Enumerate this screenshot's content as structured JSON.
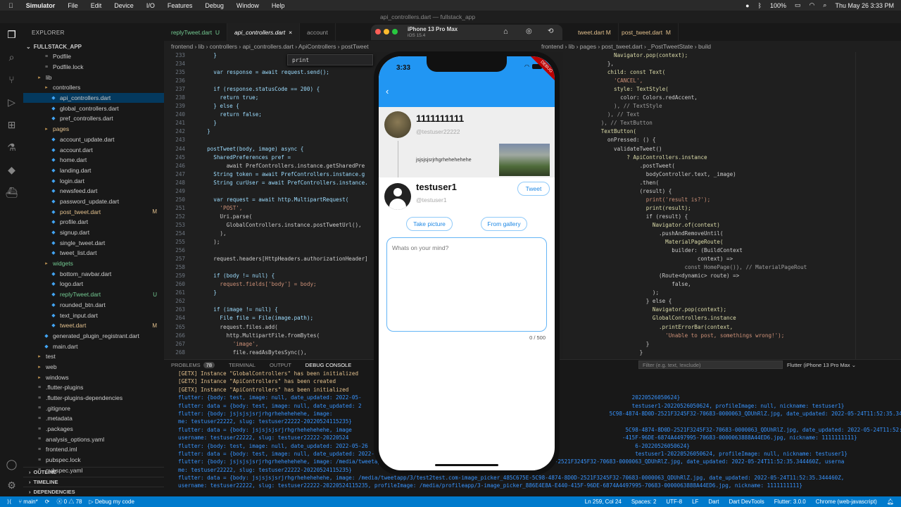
{
  "menubar": {
    "app": "Simulator",
    "items": [
      "File",
      "Edit",
      "Device",
      "I/O",
      "Features",
      "Debug",
      "Window",
      "Help"
    ],
    "battery": "100%",
    "datetime": "Thu May 26 3:33 PM"
  },
  "window_title": "api_controllers.dart — fullstack_app",
  "explorer": {
    "header": "EXPLORER",
    "project": "FULLSTACK_APP",
    "items": [
      {
        "label": "Podfile",
        "indent": 2,
        "kind": "file"
      },
      {
        "label": "Podfile.lock",
        "indent": 2,
        "kind": "file"
      },
      {
        "label": "lib",
        "indent": 1,
        "kind": "folder"
      },
      {
        "label": "controllers",
        "indent": 2,
        "kind": "folder"
      },
      {
        "label": "api_controllers.dart",
        "indent": 3,
        "kind": "dart",
        "selected": true
      },
      {
        "label": "global_controllers.dart",
        "indent": 3,
        "kind": "dart"
      },
      {
        "label": "pref_controllers.dart",
        "indent": 3,
        "kind": "dart"
      },
      {
        "label": "pages",
        "indent": 2,
        "kind": "folder",
        "color": "#e2c08d"
      },
      {
        "label": "account_update.dart",
        "indent": 3,
        "kind": "dart"
      },
      {
        "label": "account.dart",
        "indent": 3,
        "kind": "dart"
      },
      {
        "label": "home.dart",
        "indent": 3,
        "kind": "dart"
      },
      {
        "label": "landing.dart",
        "indent": 3,
        "kind": "dart"
      },
      {
        "label": "login.dart",
        "indent": 3,
        "kind": "dart"
      },
      {
        "label": "newsfeed.dart",
        "indent": 3,
        "kind": "dart"
      },
      {
        "label": "password_update.dart",
        "indent": 3,
        "kind": "dart"
      },
      {
        "label": "post_tweet.dart",
        "indent": 3,
        "kind": "dart",
        "color": "#e2c08d",
        "badge": "M"
      },
      {
        "label": "profile.dart",
        "indent": 3,
        "kind": "dart"
      },
      {
        "label": "signup.dart",
        "indent": 3,
        "kind": "dart"
      },
      {
        "label": "single_tweet.dart",
        "indent": 3,
        "kind": "dart"
      },
      {
        "label": "tweet_list.dart",
        "indent": 3,
        "kind": "dart"
      },
      {
        "label": "widgets",
        "indent": 2,
        "kind": "folder",
        "color": "#73c991"
      },
      {
        "label": "bottom_navbar.dart",
        "indent": 3,
        "kind": "dart"
      },
      {
        "label": "logo.dart",
        "indent": 3,
        "kind": "dart"
      },
      {
        "label": "replyTweet.dart",
        "indent": 3,
        "kind": "dart",
        "color": "#73c991",
        "badge": "U"
      },
      {
        "label": "rounded_btn.dart",
        "indent": 3,
        "kind": "dart"
      },
      {
        "label": "text_input.dart",
        "indent": 3,
        "kind": "dart"
      },
      {
        "label": "tweet.dart",
        "indent": 3,
        "kind": "dart",
        "color": "#e2c08d",
        "badge": "M"
      },
      {
        "label": "generated_plugin_registrant.dart",
        "indent": 2,
        "kind": "dart"
      },
      {
        "label": "main.dart",
        "indent": 2,
        "kind": "dart"
      },
      {
        "label": "test",
        "indent": 1,
        "kind": "folder"
      },
      {
        "label": "web",
        "indent": 1,
        "kind": "folder"
      },
      {
        "label": "windows",
        "indent": 1,
        "kind": "folder"
      },
      {
        "label": ".flutter-plugins",
        "indent": 1,
        "kind": "file"
      },
      {
        "label": ".flutter-plugins-dependencies",
        "indent": 1,
        "kind": "file"
      },
      {
        "label": ".gitignore",
        "indent": 1,
        "kind": "file"
      },
      {
        "label": ".metadata",
        "indent": 1,
        "kind": "file"
      },
      {
        "label": ".packages",
        "indent": 1,
        "kind": "file"
      },
      {
        "label": "analysis_options.yaml",
        "indent": 1,
        "kind": "file"
      },
      {
        "label": "frontend.iml",
        "indent": 1,
        "kind": "file"
      },
      {
        "label": "pubspec.lock",
        "indent": 1,
        "kind": "file"
      },
      {
        "label": "pubspec.yaml",
        "indent": 1,
        "kind": "file"
      }
    ],
    "outline": "OUTLINE",
    "timeline": "TIMELINE",
    "dependencies": "DEPENDENCIES"
  },
  "tabs": [
    {
      "label": "replyTweet.dart",
      "badge": "U"
    },
    {
      "label": "api_controllers.dart",
      "active": true
    },
    {
      "label": "account"
    },
    {
      "label": "tweet.dart",
      "badge": "M"
    },
    {
      "label": "post_tweet.dart",
      "badge": "M"
    }
  ],
  "breadcrumb_left": "frontend › lib › controllers › api_controllers.dart › ApiControllers › postTweet",
  "breadcrumb_right": "frontend › lib › pages › post_tweet.dart › _PostTweetState › build",
  "find_text": "print",
  "code_left": [
    {
      "n": "233",
      "t": "    }"
    },
    {
      "n": "234",
      "t": ""
    },
    {
      "n": "235",
      "t": "    var response = await request.send();"
    },
    {
      "n": "236",
      "t": ""
    },
    {
      "n": "237",
      "t": "    if (response.statusCode == 200) {"
    },
    {
      "n": "238",
      "t": "      return true;"
    },
    {
      "n": "239",
      "t": "    } else {"
    },
    {
      "n": "240",
      "t": "      return false;"
    },
    {
      "n": "241",
      "t": "    }"
    },
    {
      "n": "242",
      "t": "  }"
    },
    {
      "n": "243",
      "t": ""
    },
    {
      "n": "244",
      "t": "  postTweet(body, image) async {"
    },
    {
      "n": "245",
      "t": "    SharedPreferences pref ="
    },
    {
      "n": "246",
      "t": "        await PrefControllers.instance.getSharedPre"
    },
    {
      "n": "247",
      "t": "    String token = await PrefControllers.instance.g"
    },
    {
      "n": "248",
      "t": "    String curUser = await PrefControllers.instance."
    },
    {
      "n": "249",
      "t": ""
    },
    {
      "n": "250",
      "t": "    var request = await http.MultipartRequest("
    },
    {
      "n": "251",
      "t": "      'POST',"
    },
    {
      "n": "252",
      "t": "      Uri.parse("
    },
    {
      "n": "253",
      "t": "        GlobalControllers.instance.postTweetUrl(),"
    },
    {
      "n": "254",
      "t": "      ),"
    },
    {
      "n": "255",
      "t": "    );"
    },
    {
      "n": "256",
      "t": ""
    },
    {
      "n": "257",
      "t": "    request.headers[HttpHeaders.authorizationHeader]"
    },
    {
      "n": "258",
      "t": ""
    },
    {
      "n": "259",
      "t": "    if (body != null) {"
    },
    {
      "n": "260",
      "t": "      request.fields['body'] = body;"
    },
    {
      "n": "261",
      "t": "    }"
    },
    {
      "n": "262",
      "t": ""
    },
    {
      "n": "263",
      "t": "    if (image != null) {"
    },
    {
      "n": "264",
      "t": "      File file = File(image.path);"
    },
    {
      "n": "265",
      "t": "      request.files.add("
    },
    {
      "n": "266",
      "t": "        http.MultipartFile.fromBytes("
    },
    {
      "n": "267",
      "t": "          'image',"
    },
    {
      "n": "268",
      "t": "          file.readAsBytesSync(),"
    }
  ],
  "code_right": [
    "              Navigator.pop(context);",
    "            },",
    "            child: const Text(",
    "              'CANCEL',",
    "              style: TextStyle(",
    "                color: Colors.redAccent,",
    "              ), // TextStyle",
    "            ), // Text",
    "          ), // TextButton",
    "          TextButton(",
    "            onPressed: () {",
    "              validateTweet()",
    "                  ? ApiControllers.instance",
    "                      .postTweet(",
    "                        bodyController.text, _image)",
    "                      .then(",
    "                      (result) {",
    "                        print('result is?');",
    "                        print(result);",
    "                        if (result) {",
    "                          Navigator.of(context)",
    "                            .pushAndRemoveUntil(",
    "                              MaterialPageRoute(",
    "                                builder: (BuildContext",
    "                                        context) =>",
    "                                    const HomePage()), // MaterialPageRout",
    "                            (Route<dynamic> route) =>",
    "                                false,",
    "                          );",
    "                        } else {",
    "                          Navigator.pop(context);",
    "                          GlobalControllers.instance",
    "                            .printErrorBar(context,",
    "                              'Unable to post, somethings wrong!');",
    "                        }",
    "                      }"
  ],
  "panel": {
    "tabs": [
      "PROBLEMS",
      "TERMINAL",
      "OUTPUT",
      "DEBUG CONSOLE"
    ],
    "problems_count": "78",
    "filter_placeholder": "Filter (e.g. text, !exclude)",
    "device": "Flutter (iPhone 13 Pro Max"
  },
  "console": [
    {
      "t": "[GETX] Instance \"GlobalControllers\" has been initialized",
      "y": true
    },
    {
      "t": "[GETX] Instance \"ApiControllers\" has been created",
      "y": true
    },
    {
      "t": "[GETX] Instance \"ApiControllers\" has been initialized",
      "y": true
    },
    {
      "t": "flutter: {body: test, image: null, date_updated: 2022-05-                                                                                    20220526050624}"
    },
    {
      "t": "flutter: data = {body: test, image: null, date_updated: 2                                                                                    testuser1-20220526050624, profileImage: null, nickname: testuser1}"
    },
    {
      "t": "flutter: {body: jsjsjsjsrjrhgrhehehehehe, image:                                                                                      5C98-4874-8D0D-2521F3245F32-70683-0000063_QDUhRlZ.jpg, date_updated: 2022-05-24T11:52:35.344460Z, userna"
    },
    {
      "t": "me: testuser22222, slug: testuser22222-20220524115235}"
    },
    {
      "t": "flutter: data = {body: jsjsjsjsrjrhgrhehehehehe, image                                                                                     5C98-4874-8D0D-2521F3245F32-70683-0000063_QDUhRlZ.jpg, date_updated: 2022-05-24T11:52:35.344460Z,"
    },
    {
      "t": "username: testuser22222, slug: testuser22222-20220524                                                                                     -415F-96DE-6874A4497995-70683-0000063888A44ED6.jpg, nickname: 1111111111}"
    },
    {
      "t": "flutter: {body: test, image: null, date_updated: 2022-05-26                                                                                   6-20220526050624}"
    },
    {
      "t": "flutter: data = {body: test, image: null, date_updated: 2022-                                                                                 testuser1-20220526050624, profileImage: null, nickname: testuser1}"
    },
    {
      "t": "flutter: {body: jsjsjsjsrjrhgrhehehehehe, image: /media/tweetapp/3/test2test.com-image_picker_485C675E-5C98-4874-8D0D-2521F3245F32-70683-0000063_QDUhRlZ.jpg, date_updated: 2022-05-24T11:52:35.344460Z, userna"
    },
    {
      "t": "me: testuser22222, slug: testuser22222-20220524115235}"
    },
    {
      "t": "flutter: data = {body: jsjsjsjsrjrhgrhehehehehe, image: /media/tweetapp/3/test2test.com-image_picker_485C675E-5C98-4874-8D0D-2521F3245F32-70683-0000063_QDUhRlZ.jpg, date_updated: 2022-05-24T11:52:35.344460Z,"
    },
    {
      "t": "username: testuser22222, slug: testuser22222-20220524115235, profileImage: /media/profileapp/3-image_picker_886E4E8A-E440-415F-96DE-6874A4497995-70683-0000063888A44ED6.jpg, nickname: 1111111111}"
    }
  ],
  "statusbar": {
    "branch": "main*",
    "errors": "0",
    "warnings": "78",
    "debug": "Debug my code",
    "position": "Ln 259, Col 24",
    "spaces": "Spaces: 2",
    "encoding": "UTF-8",
    "eol": "LF",
    "lang": "Dart",
    "devtools": "Dart DevTools",
    "flutter": "Flutter: 3.0.0",
    "device": "Chrome (web-javascript)"
  },
  "simulator": {
    "device": "iPhone 13 Pro Max",
    "os": "iOS 15.4",
    "time": "3:33",
    "debug": "DEBUG"
  },
  "app": {
    "original_tweet": {
      "name": "1111111111",
      "handle": "@testuser22222",
      "body": "jsjsjsjsrjrhgrhehehehehe"
    },
    "compose": {
      "name": "testuser1",
      "handle": "@testuser1",
      "tweet_button": "Tweet",
      "take_picture": "Take picture",
      "from_gallery": "From gallery",
      "placeholder": "Whats on your mind?",
      "counter": "0 / 500"
    }
  },
  "colors": {
    "accent": "#2196f3",
    "statusbar": "#007acc",
    "selection": "#04395e"
  }
}
